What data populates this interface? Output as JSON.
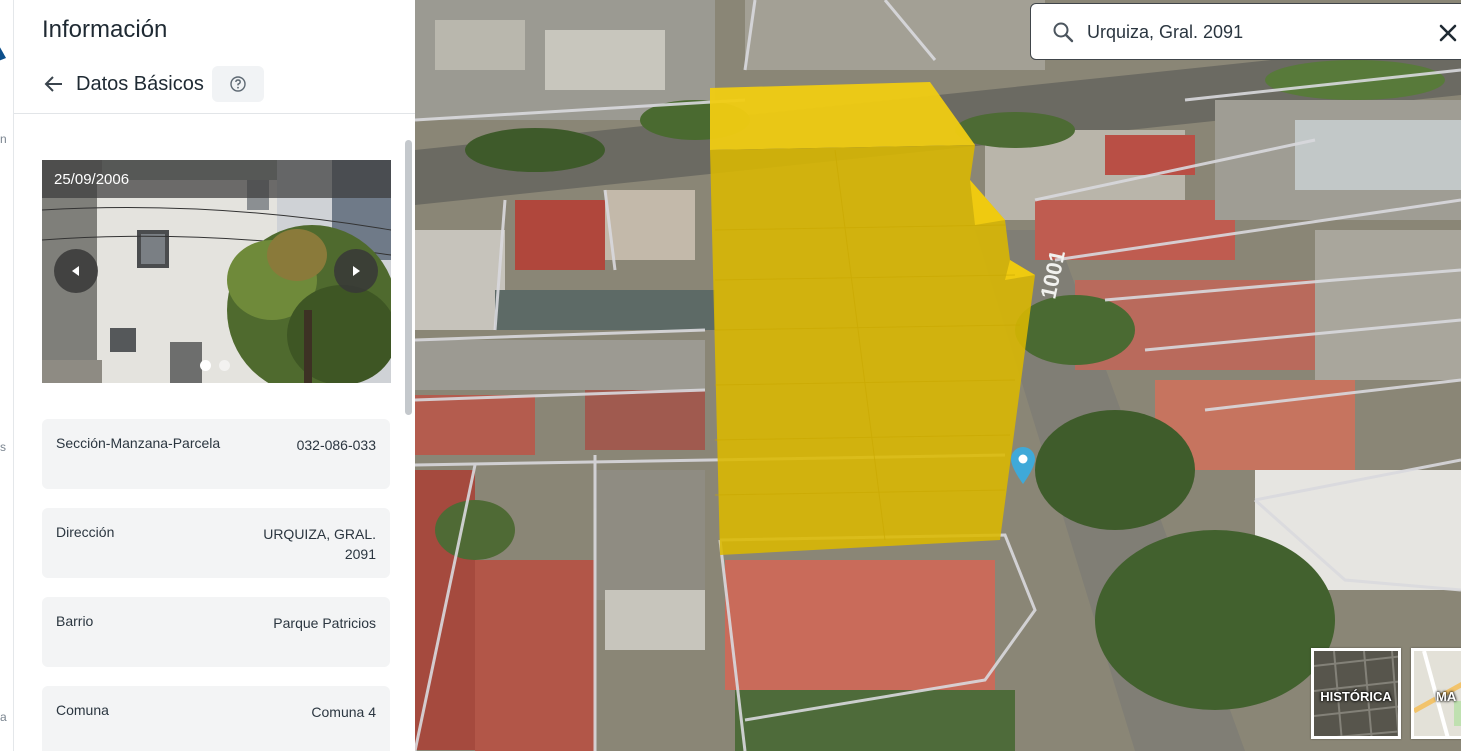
{
  "panel": {
    "title": "Información",
    "section_title": "Datos Básicos"
  },
  "photo": {
    "date": "25/09/2006",
    "slide_count": 2,
    "active_slide": 1
  },
  "details": [
    {
      "key": "Sección-Manzana-Parcela",
      "value": "032-086-033"
    },
    {
      "key": "Dirección",
      "value": "URQUIZA, GRAL. 2091"
    },
    {
      "key": "Barrio",
      "value": "Parque Patricios"
    },
    {
      "key": "Comuna",
      "value": "Comuna 4"
    }
  ],
  "map": {
    "street_label": "1001",
    "search": {
      "value": "Urquiza, Gral. 2091"
    },
    "layers": {
      "historic_label": "HISTÓRICA",
      "map_label": "MA"
    }
  },
  "rail": {
    "fragments": [
      "n",
      "s",
      "a"
    ]
  },
  "colors": {
    "building": "#e9c300",
    "marker": "#3fa9d8",
    "accent": "#0d4f8b"
  }
}
